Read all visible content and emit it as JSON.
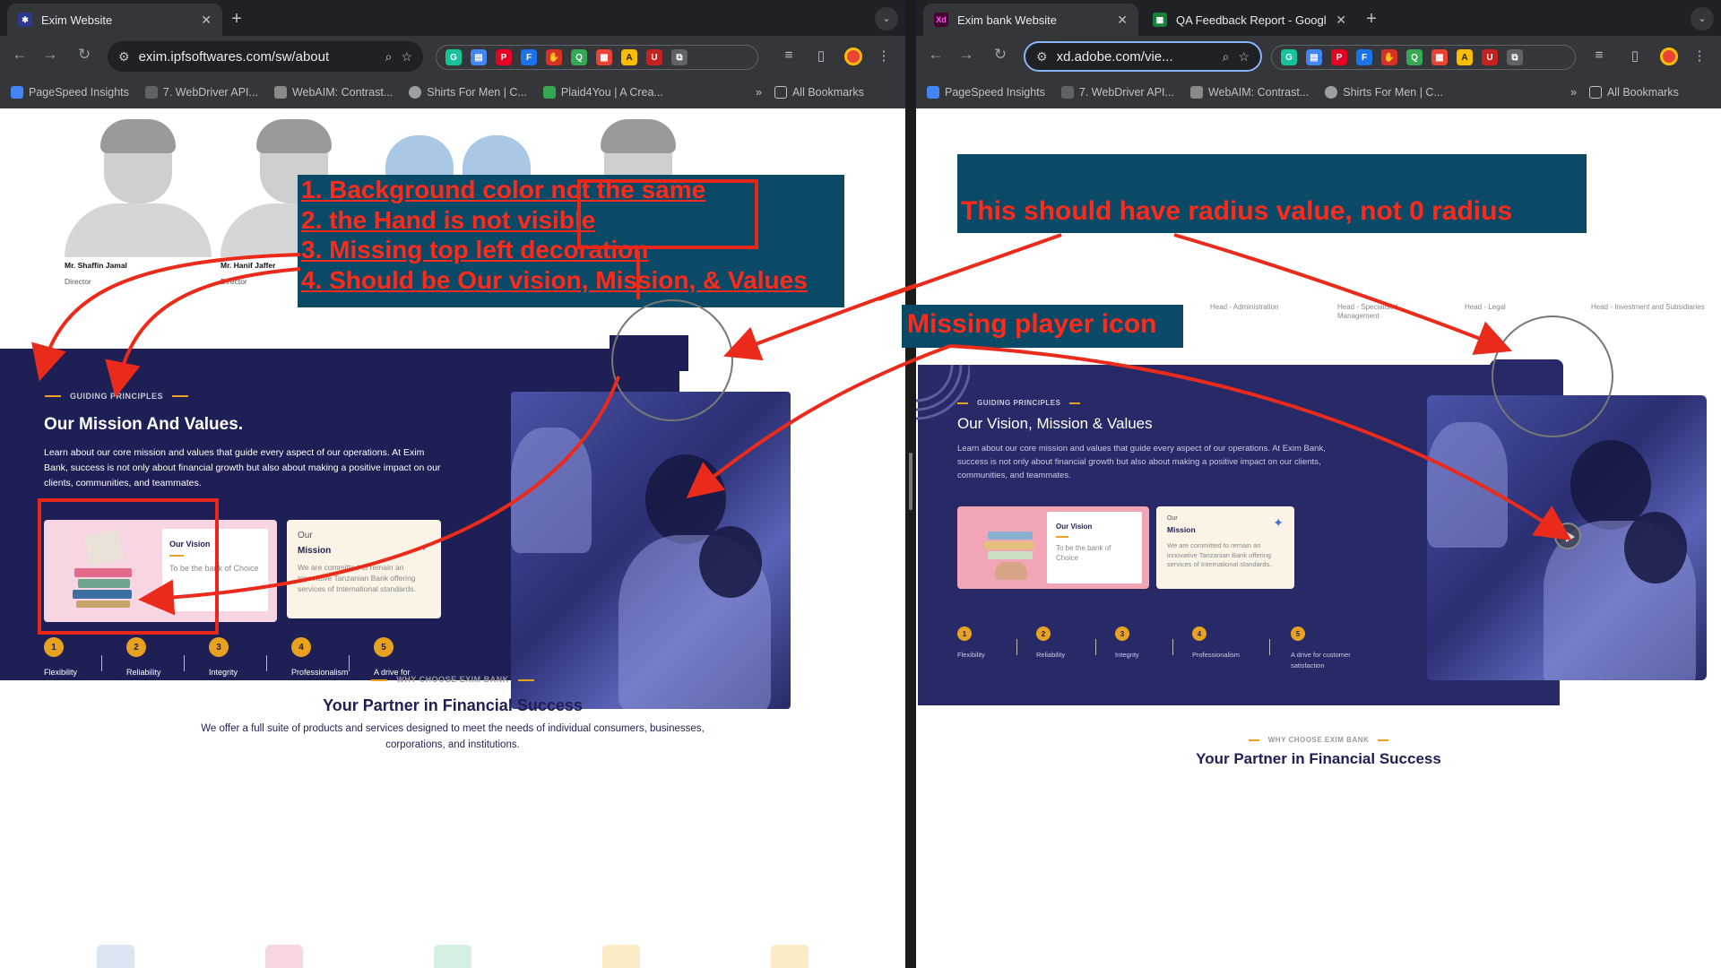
{
  "left_window": {
    "tabs": [
      {
        "title": "Exim Website",
        "favicon": "gear-favicon"
      }
    ],
    "url": "exim.ipfsoftwares.com/sw/about",
    "bookmarks": [
      "PageSpeed Insights",
      "7. WebDriver API...",
      "WebAIM: Contrast...",
      "Shirts For Men | C...",
      "Plaid4You | A Crea..."
    ],
    "all_bookmarks": "All Bookmarks"
  },
  "right_window": {
    "tabs": [
      {
        "title": "Exim bank Website",
        "favicon": "xd-favicon"
      },
      {
        "title": "QA Feedback Report - Googl",
        "favicon": "sheets-favicon"
      }
    ],
    "url": "xd.adobe.com/vie...",
    "bookmarks": [
      "PageSpeed Insights",
      "7. WebDriver API...",
      "WebAIM: Contrast...",
      "Shirts For Men | C..."
    ],
    "all_bookmarks": "All Bookmarks"
  },
  "team": [
    {
      "name": "Mr. Shaffin Jamal",
      "role": "Director"
    },
    {
      "name": "Mr. Hanif Jaffer",
      "role": "Director"
    }
  ],
  "right_team_roles": [
    "Head - Administration",
    "Head - Specialised Management",
    "Head - Legal",
    "Head - Investment and Subsidiaries"
  ],
  "left_site": {
    "eyebrow": "GUIDING PRINCIPLES",
    "heading": "Our Mission And Values.",
    "paragraph": "Learn about our core mission and values that guide every aspect of our operations. At Exim Bank, success is not only about financial growth but also about making a positive impact on our clients, communities, and teammates.",
    "vision_title": "Our Vision",
    "vision_text": "To be the bank of Choice",
    "mission_pre": "Our",
    "mission_title": "Mission",
    "mission_text": "We are committed to remain an innovative Tanzanian Bank offering services of International standards.",
    "values": [
      "Flexibility",
      "Reliability",
      "Integrity",
      "Professionalism",
      "A drive for customer satisfaction"
    ],
    "why_eyebrow": "WHY CHOOSE EXIM BANK",
    "partner_heading": "Your Partner in Financial Success",
    "partner_sub": "We offer a full suite of products and services designed to meet the needs of individual consumers, businesses, corporations, and institutions."
  },
  "right_site": {
    "eyebrow": "GUIDING PRINCIPLES",
    "heading": "Our Vision, Mission & Values",
    "paragraph": "Learn about our core mission and values that guide every aspect of our operations. At Exim Bank, success is not only about financial growth but also about making a positive impact on our clients, communities, and teammates.",
    "vision_title": "Our Vision",
    "vision_text": "To be the bank of Choice",
    "mission_pre": "Our",
    "mission_title": "Mission",
    "mission_text": "We are committed to remain an innovative Tanzanian Bank offering services of International standards.",
    "values": [
      "Flexibility",
      "Reliability",
      "Integrity",
      "Professionalism",
      "A drive for customer satisfaction"
    ],
    "why_eyebrow": "WHY CHOOSE EXIM BANK",
    "partner_heading": "Your Partner in Financial Success"
  },
  "annotations": {
    "left_note": [
      "1. Background color not the same",
      "2. the Hand is not visible",
      "3. Missing top left decoration",
      "4. Should be Our vision, Mission, & Values"
    ],
    "radius_note": "This should have radius value, not 0 radius",
    "player_note": "Missing player icon"
  },
  "colors": {
    "navy": "#1e1f55",
    "accent": "#e8a220",
    "annotation_red": "#ff2a1a",
    "annotation_bg": "#0a4a66"
  }
}
